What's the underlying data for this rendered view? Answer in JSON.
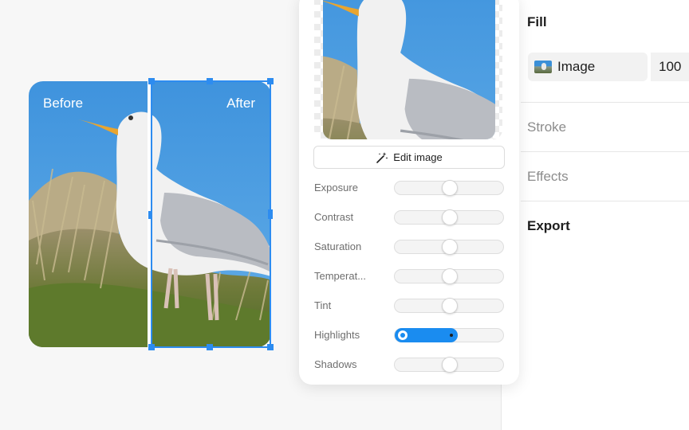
{
  "canvas": {
    "before_label": "Before",
    "after_label": "After"
  },
  "image_panel": {
    "edit_button_label": "Edit image",
    "edit_button_icon": "magic-wand-icon",
    "adjustments": [
      {
        "label": "Exposure",
        "value": 0.5
      },
      {
        "label": "Contrast",
        "value": 0.5
      },
      {
        "label": "Saturation",
        "value": 0.5
      },
      {
        "label": "Temperat...",
        "value": 0.5
      },
      {
        "label": "Tint",
        "value": 0.5
      },
      {
        "label": "Highlights",
        "value": 0.57,
        "active": true
      },
      {
        "label": "Shadows",
        "value": 0.5
      }
    ]
  },
  "properties": {
    "fill_title": "Fill",
    "fill_type": "Image",
    "fill_opacity": "100",
    "stroke_title": "Stroke",
    "effects_title": "Effects",
    "export_title": "Export"
  },
  "colors": {
    "accent": "#2d8cf0",
    "slider_active": "#1a8cf0",
    "sky": "#3a8fd8"
  }
}
